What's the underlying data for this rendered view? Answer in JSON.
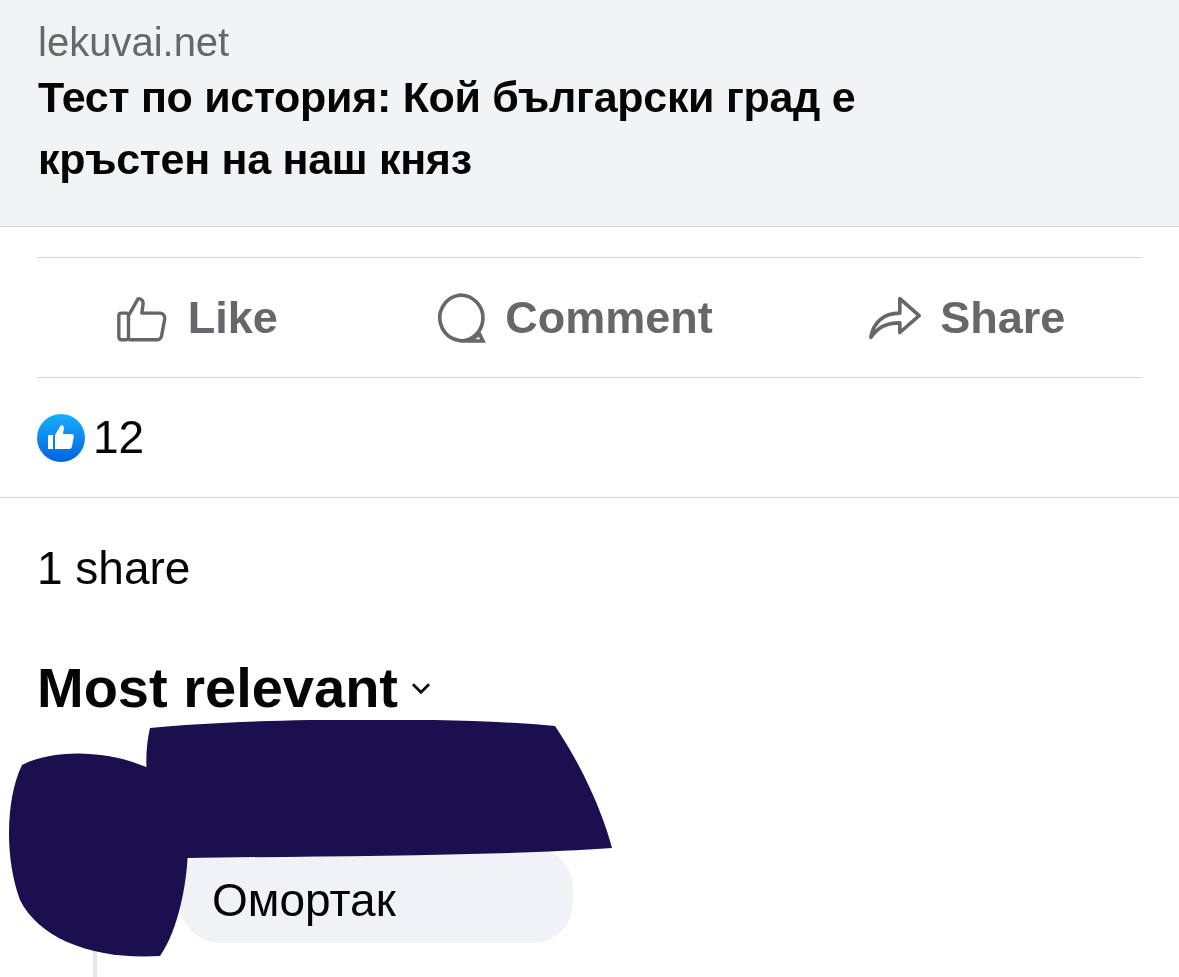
{
  "link_preview": {
    "domain": "lekuvai.net",
    "title": "Тест по история: Кой български град е кръстен на наш княз"
  },
  "actions": [
    {
      "kind": "like",
      "label": "Like"
    },
    {
      "kind": "comment",
      "label": "Comment"
    },
    {
      "kind": "share",
      "label": "Share"
    }
  ],
  "reactions": {
    "count": "12"
  },
  "shares": "1 share",
  "sort": {
    "label": "Most relevant"
  },
  "comments": [
    {
      "text": "Омортак",
      "redacted": true
    }
  ]
}
